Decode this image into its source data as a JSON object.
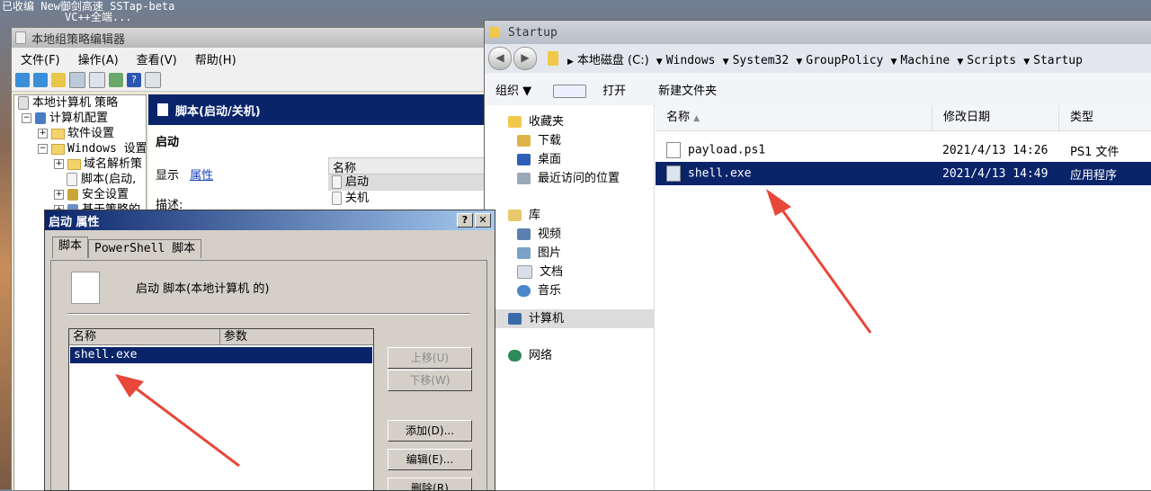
{
  "desktop": {
    "line1": "已收编   New御剑高速  SSTap-beta",
    "line2": "VC++全端..."
  },
  "gpo": {
    "title": "本地组策略编辑器",
    "menu": [
      "文件(F)",
      "操作(A)",
      "查看(V)",
      "帮助(H)"
    ],
    "tree": [
      {
        "label": "本地计算机 策略",
        "indent": 0,
        "exp": ""
      },
      {
        "label": "计算机配置",
        "indent": 1,
        "exp": "⊟"
      },
      {
        "label": "软件设置",
        "indent": 2,
        "exp": "⊞"
      },
      {
        "label": "Windows 设置",
        "indent": 2,
        "exp": "⊟"
      },
      {
        "label": "域名解析策",
        "indent": 3,
        "exp": "⊞"
      },
      {
        "label": "脚本(启动,",
        "indent": 3,
        "exp": ""
      },
      {
        "label": "安全设置",
        "indent": 3,
        "exp": "⊞"
      },
      {
        "label": "基于策略的",
        "indent": 3,
        "exp": "⊞"
      }
    ],
    "header": "脚本(启动/关机)",
    "pane_title": "启动",
    "show_label": "显示",
    "props_link": "属性",
    "desc_label": "描述:",
    "list_header": "名称",
    "list_items": [
      "启动",
      "关机"
    ]
  },
  "explorer": {
    "title": "Startup",
    "breadcrumb": [
      "本地磁盘 (C:)",
      "Windows",
      "System32",
      "GroupPolicy",
      "Machine",
      "Scripts",
      "Startup"
    ],
    "cmd": {
      "organize": "组织 ▼",
      "open": "打开",
      "new_folder": "新建文件夹"
    },
    "nav": {
      "favorites": "收藏夹",
      "downloads": "下载",
      "desktop": "桌面",
      "recent": "最近访问的位置",
      "library": "库",
      "video": "视频",
      "pictures": "图片",
      "docs": "文档",
      "music": "音乐",
      "computer": "计算机",
      "network": "网络"
    },
    "columns": {
      "name": "名称",
      "date": "修改日期",
      "type": "类型"
    },
    "files": [
      {
        "name": "payload.ps1",
        "date": "2021/4/13 14:26",
        "type": "PS1 文件"
      },
      {
        "name": "shell.exe",
        "date": "2021/4/13 14:49",
        "type": "应用程序"
      }
    ]
  },
  "dialog": {
    "title": "启动 属性",
    "help": "?",
    "close": "✕",
    "tabs": [
      "脚本",
      "PowerShell 脚本"
    ],
    "desc": "启动 脚本(本地计算机 的)",
    "columns": {
      "name": "名称",
      "params": "参数"
    },
    "item": "shell.exe",
    "buttons": {
      "up": "上移(U)",
      "down": "下移(W)",
      "add": "添加(D)...",
      "edit": "编辑(E)...",
      "remove": "删除(R)"
    }
  },
  "colors": {
    "selection": "#0a246a",
    "arrow": "#e8473a"
  }
}
